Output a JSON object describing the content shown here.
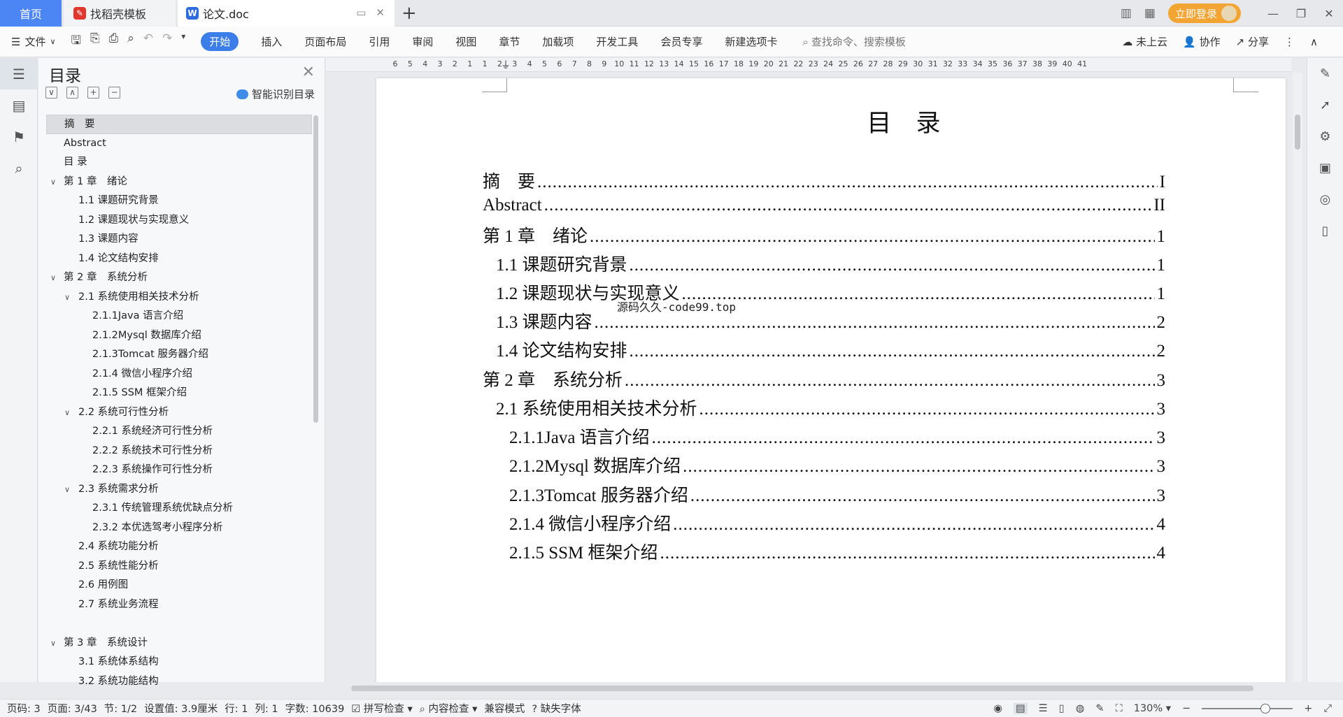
{
  "tabs": {
    "home": "首页",
    "templates": "找稻壳模板",
    "document": "论文.doc"
  },
  "titlebar": {
    "login": "立即登录"
  },
  "ribbon": {
    "file": "文件",
    "tabs": [
      "开始",
      "插入",
      "页面布局",
      "引用",
      "审阅",
      "视图",
      "章节",
      "加载项",
      "开发工具",
      "会员专享",
      "新建选项卡"
    ],
    "search_placeholder": "查找命令、搜索模板",
    "cloud": "未上云",
    "collab": "协作",
    "share": "分享"
  },
  "toc_panel": {
    "title": "目录",
    "smart_button": "智能识别目录",
    "items": [
      {
        "label": "摘　要",
        "level": 0
      },
      {
        "label": "Abstract",
        "level": 0
      },
      {
        "label": "目 录",
        "level": 0
      },
      {
        "label": "第 1 章　绪论",
        "level": 0
      },
      {
        "label": "1.1 课题研究背景",
        "level": 1
      },
      {
        "label": "1.2 课题现状与实现意义",
        "level": 1
      },
      {
        "label": "1.3 课题内容",
        "level": 1
      },
      {
        "label": "1.4 论文结构安排",
        "level": 1
      },
      {
        "label": "第 2 章　系统分析",
        "level": 0
      },
      {
        "label": "2.1 系统使用相关技术分析",
        "level": 1
      },
      {
        "label": "2.1.1Java 语言介绍",
        "level": 2
      },
      {
        "label": "2.1.2Mysql 数据库介绍",
        "level": 2
      },
      {
        "label": "2.1.3Tomcat 服务器介绍",
        "level": 2
      },
      {
        "label": "2.1.4 微信小程序介绍",
        "level": 2
      },
      {
        "label": "2.1.5 SSM 框架介绍",
        "level": 2
      },
      {
        "label": "2.2 系统可行性分析",
        "level": 1
      },
      {
        "label": "2.2.1 系统经济可行性分析",
        "level": 2
      },
      {
        "label": "2.2.2 系统技术可行性分析",
        "level": 2
      },
      {
        "label": "2.2.3 系统操作可行性分析",
        "level": 2
      },
      {
        "label": "2.3 系统需求分析",
        "level": 1
      },
      {
        "label": "2.3.1 传统管理系统优缺点分析",
        "level": 2
      },
      {
        "label": "2.3.2 本优选驾考小程序分析",
        "level": 2
      },
      {
        "label": "2.4 系统功能分析",
        "level": 1
      },
      {
        "label": "2.5 系统性能分析",
        "level": 1
      },
      {
        "label": "2.6 用例图",
        "level": 1
      },
      {
        "label": "2.7 系统业务流程",
        "level": 1
      },
      {
        "label": "第 3 章　系统设计",
        "level": 0
      },
      {
        "label": "3.1 系统体系结构",
        "level": 1
      },
      {
        "label": "3.2 系统功能结构",
        "level": 1
      }
    ]
  },
  "ruler": {
    "labels": [
      "6",
      "5",
      "4",
      "3",
      "2",
      "1",
      "1",
      "2",
      "3",
      "4",
      "5",
      "6",
      "7",
      "8",
      "9",
      "10",
      "11",
      "12",
      "13",
      "14",
      "15",
      "16",
      "17",
      "18",
      "19",
      "20",
      "21",
      "22",
      "23",
      "24",
      "25",
      "26",
      "27",
      "28",
      "29",
      "30",
      "31",
      "32",
      "33",
      "34",
      "35",
      "36",
      "37",
      "38",
      "39",
      "40",
      "41"
    ]
  },
  "document": {
    "title": "目 录",
    "watermark": "源码久久-code99.top",
    "entries": [
      {
        "label": "摘　要",
        "page": "I"
      },
      {
        "label": "Abstract",
        "page": "II"
      },
      {
        "label": "第 1 章　绪论",
        "page": "1"
      },
      {
        "label": "1.1 课题研究背景",
        "page": "1"
      },
      {
        "label": "1.2 课题现状与实现意义",
        "page": "1"
      },
      {
        "label": "1.3 课题内容",
        "page": "2"
      },
      {
        "label": "1.4 论文结构安排",
        "page": "2"
      },
      {
        "label": "第 2 章　系统分析",
        "page": "3"
      },
      {
        "label": "2.1 系统使用相关技术分析",
        "page": "3"
      },
      {
        "label": "2.1.1Java 语言介绍",
        "page": "3"
      },
      {
        "label": "2.1.2Mysql 数据库介绍",
        "page": "3"
      },
      {
        "label": "2.1.3Tomcat 服务器介绍",
        "page": "3"
      },
      {
        "label": "2.1.4 微信小程序介绍",
        "page": "4"
      },
      {
        "label": "2.1.5 SSM 框架介绍",
        "page": "4"
      }
    ]
  },
  "status": {
    "page_num": "页码: 3",
    "pages": "页面: 3/43",
    "section": "节: 1/2",
    "setting": "设置值: 3.9厘米",
    "row": "行: 1",
    "col": "列: 1",
    "words": "字数: 10639",
    "spell": "拼写检查",
    "content_check": "内容检查",
    "compat": "兼容模式",
    "missing_font": "缺失字体",
    "zoom": "130%"
  }
}
